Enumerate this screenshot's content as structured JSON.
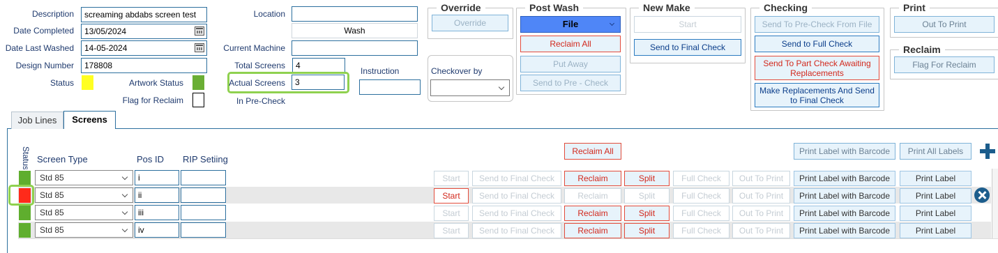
{
  "fields": {
    "description_label": "Description",
    "description_value": "screaming abdabs screen test",
    "date_completed_label": "Date Completed",
    "date_completed_value": "13/05/2024",
    "date_last_washed_label": "Date Last Washed",
    "date_last_washed_value": "14-05-2024",
    "design_number_label": "Design Number",
    "design_number_value": "178808",
    "status_label": "Status",
    "artwork_status_label": "Artwork Status",
    "flag_reclaim_label": "Flag for Reclaim",
    "location_label": "Location",
    "location_value": "",
    "wash_value": "Wash",
    "current_machine_label": "Current Machine",
    "total_screens_label": "Total Screens",
    "total_screens_value": "4",
    "actual_screens_label": "Actual Screens",
    "actual_screens_value": "3",
    "in_precheck_label": "In Pre-Check",
    "instruction_label": "Instruction",
    "checkover_label": "Checkover by"
  },
  "colors": {
    "status_yellow": "#ffff22",
    "artwork_green": "#6aae34",
    "row_status_green": "#5fae2e",
    "row_status_red": "#ff2a1a",
    "highlight_green": "#8fd14f",
    "file_blue": "#4f86f7"
  },
  "groups": {
    "override": {
      "title": "Override",
      "button": "Override"
    },
    "post_wash": {
      "title": "Post Wash",
      "file": "File",
      "reclaim_all": "Reclaim All",
      "put_away": "Put Away",
      "send_precheck": "Send to Pre - Check"
    },
    "new_make": {
      "title": "New Make",
      "start": "Start",
      "send_final": "Send to Final Check"
    },
    "checking": {
      "title": "Checking",
      "send_precheck_file": "Send To Pre-Check From File",
      "send_full": "Send to Full Check",
      "send_part": "Send To Part Check Awaiting Replacements",
      "make_replacements": "Make Replacements And Send to Final Check"
    },
    "print": {
      "title": "Print",
      "out_to_print": "Out To Print"
    },
    "reclaim": {
      "title": "Reclaim",
      "flag": "Flag For Reclaim"
    }
  },
  "tabs": [
    "Job Lines",
    "Screens"
  ],
  "grid": {
    "status_header": "Status",
    "screen_type_header": "Screen Type",
    "pos_id_header": "Pos ID",
    "rip_header": "RIP Setiing",
    "reclaim_all": "Reclaim All",
    "print_label_barcode": "Print Label with Barcode",
    "print_all_labels": "Print All Labels",
    "row_buttons": {
      "start": "Start",
      "send_final": "Send to Final Check",
      "reclaim": "Reclaim",
      "split": "Split",
      "full_check": "Full Check",
      "out_to_print": "Out To Print",
      "print_barcode": "Print Label with Barcode",
      "print_label": "Print Label"
    },
    "rows": [
      {
        "screen_type": "Std 85",
        "pos_id": "i",
        "rip": "",
        "status": "green"
      },
      {
        "screen_type": "Std 85",
        "pos_id": "ii",
        "rip": "",
        "status": "red"
      },
      {
        "screen_type": "Std 85",
        "pos_id": "iii",
        "rip": "",
        "status": "green"
      },
      {
        "screen_type": "Std 85",
        "pos_id": "iv",
        "rip": "",
        "status": "green"
      }
    ]
  },
  "icons": {
    "add": "plus-icon",
    "remove": "close-circle-icon"
  }
}
